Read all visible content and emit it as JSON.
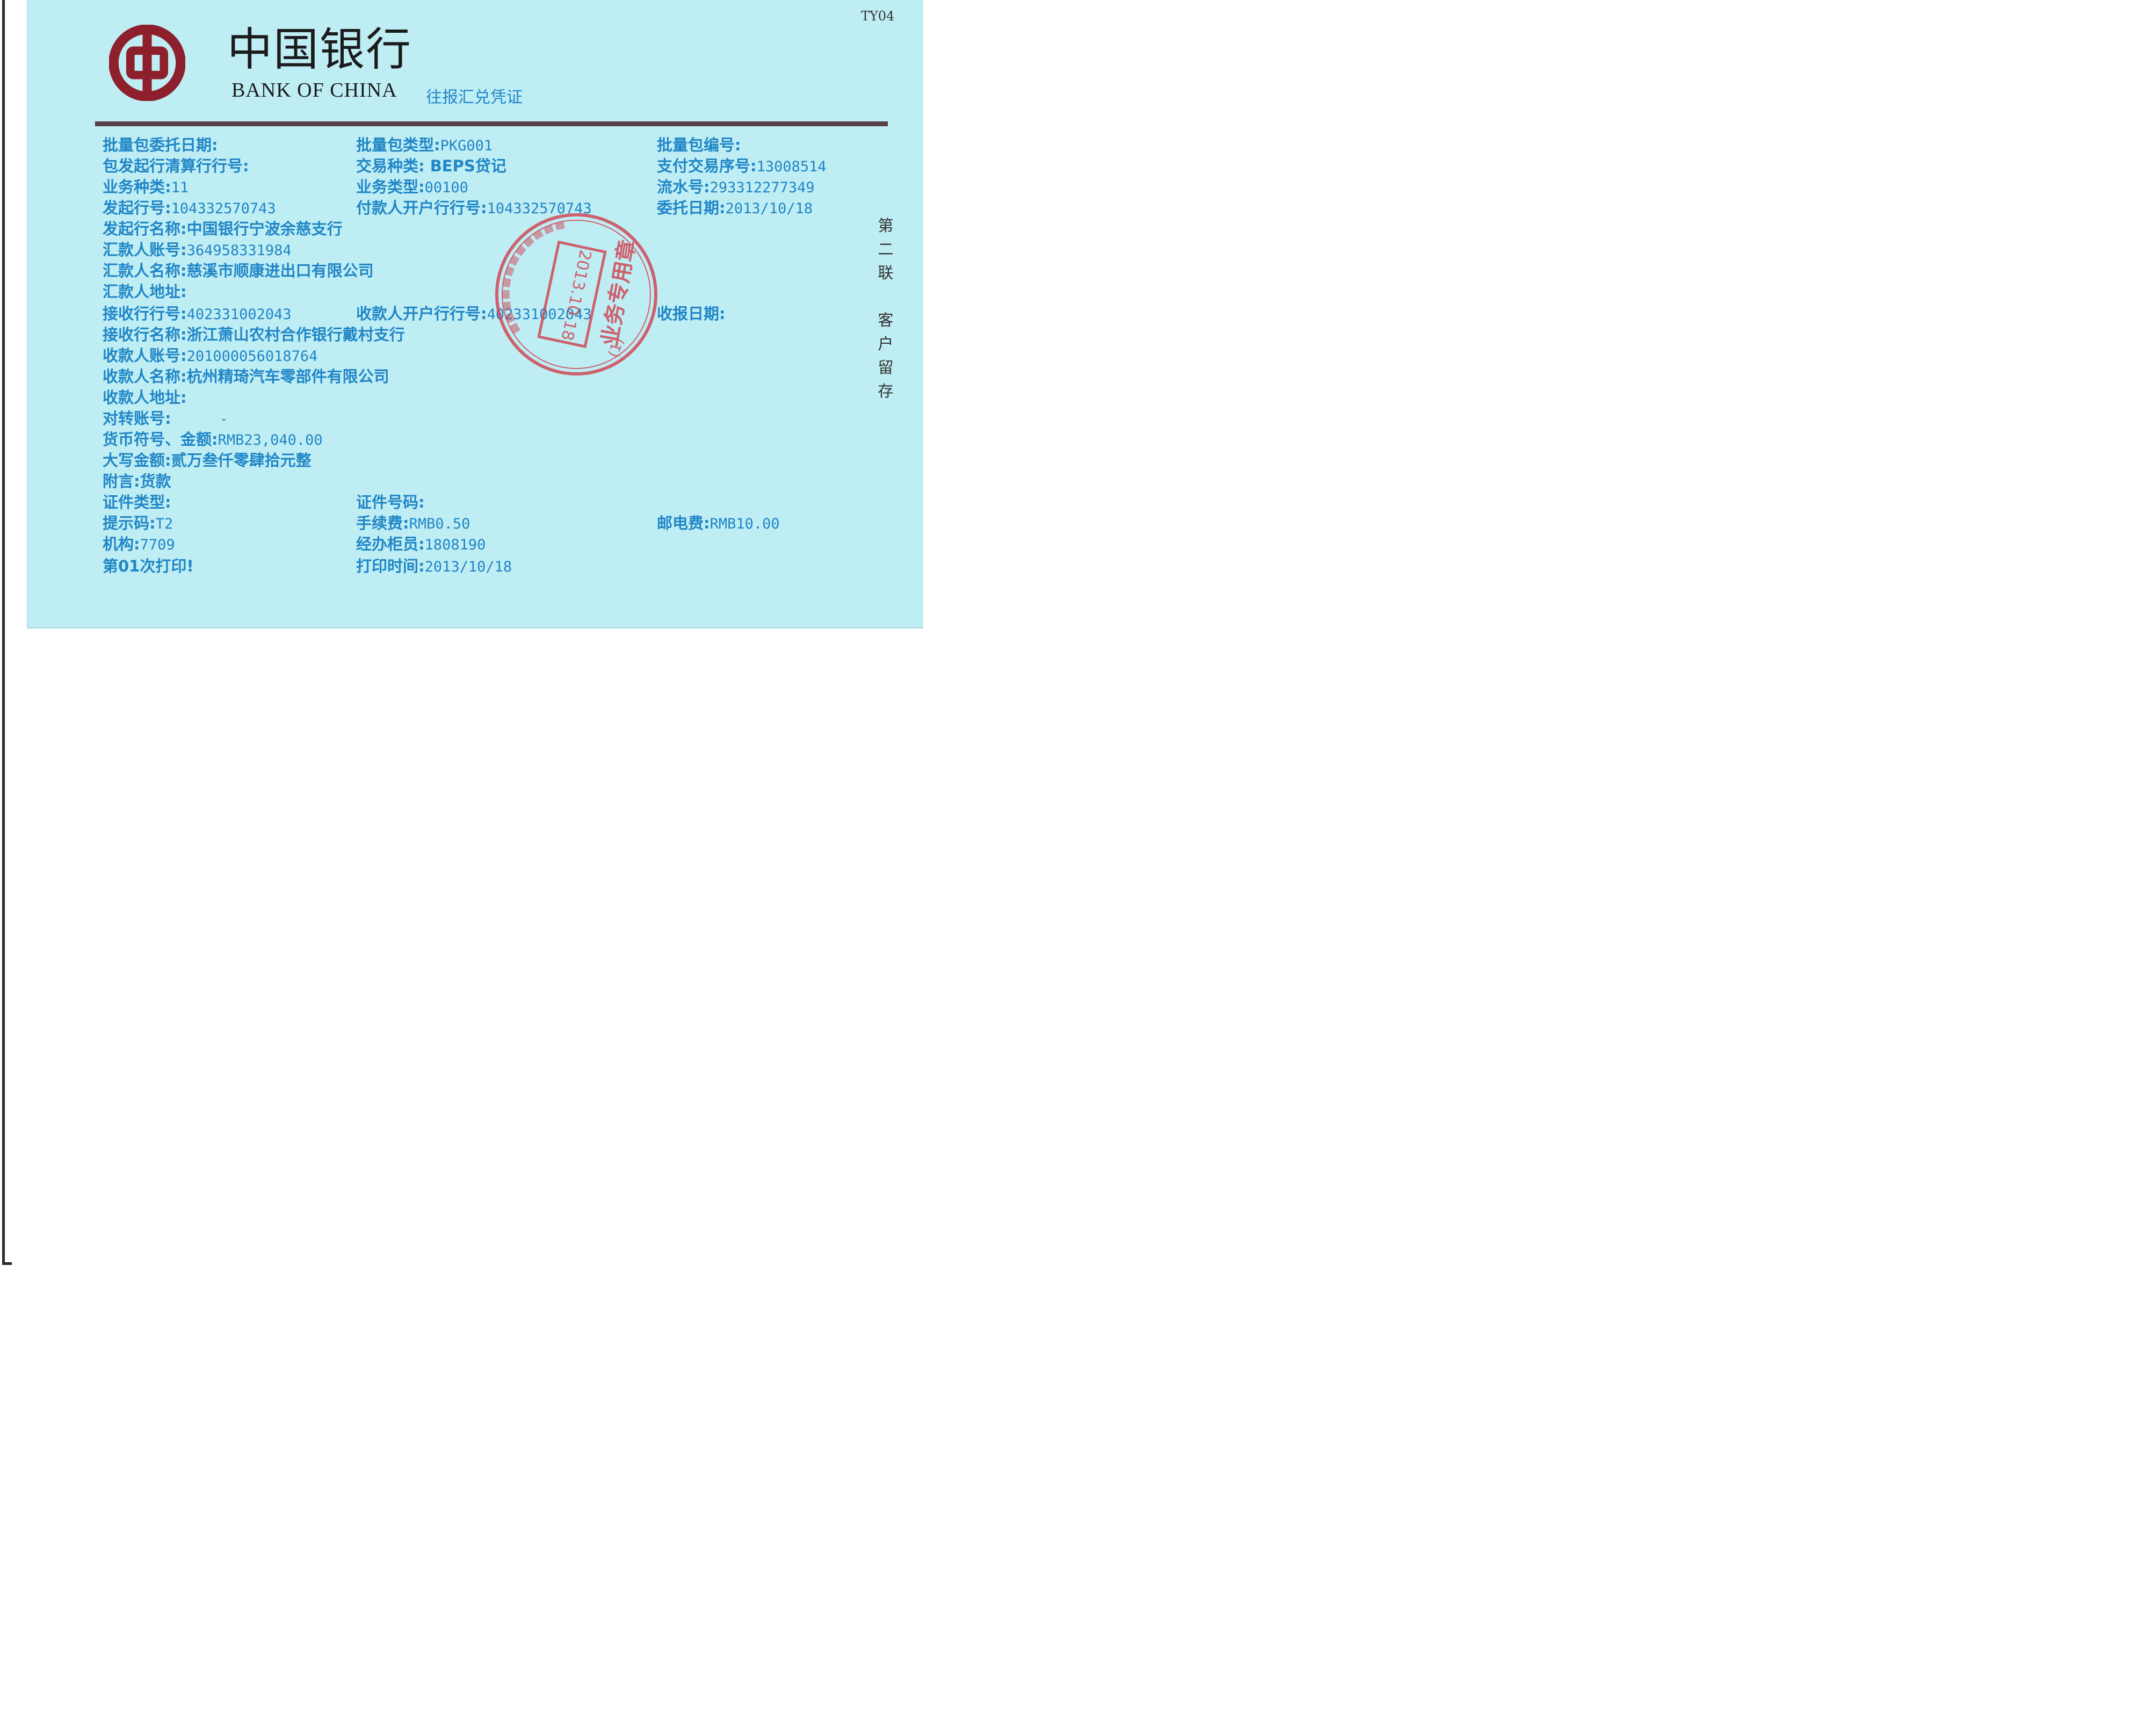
{
  "form_code": "TY04",
  "bank": {
    "name_cn": "中国银行",
    "name_en": "BANK OF CHINA",
    "doc_title": "往报汇兑凭证"
  },
  "fields": {
    "pkg_date": {
      "label": "批量包委托日期:",
      "value": ""
    },
    "pkg_type": {
      "label": "批量包类型:",
      "value": "PKG001"
    },
    "pkg_no": {
      "label": "批量包编号:",
      "value": ""
    },
    "clearing_bank": {
      "label": "包发起行清算行行号:",
      "value": ""
    },
    "txn_kind": {
      "label": "交易种类:",
      "value": " BEPS贷记"
    },
    "pay_seq": {
      "label": "支付交易序号:",
      "value": "13008514"
    },
    "biz_category": {
      "label": "业务种类:",
      "value": "11"
    },
    "biz_type": {
      "label": "业务类型:",
      "value": "00100"
    },
    "serial_no": {
      "label": "流水号:",
      "value": "293312277349"
    },
    "orig_bank_no": {
      "label": "发起行号:",
      "value": "104332570743"
    },
    "payer_bank_no": {
      "label": "付款人开户行行号:",
      "value": "104332570743"
    },
    "entrust_date": {
      "label": "委托日期:",
      "value": "2013/10/18"
    },
    "orig_bank_name": {
      "label": "发起行名称:",
      "value": "中国银行宁波余慈支行"
    },
    "remitter_acct": {
      "label": "汇款人账号:",
      "value": "364958331984"
    },
    "remitter_name": {
      "label": "汇款人名称:",
      "value": "慈溪市顺康进出口有限公司"
    },
    "remitter_addr": {
      "label": "汇款人地址:",
      "value": ""
    },
    "recv_bank_no": {
      "label": "接收行行号:",
      "value": "402331002043"
    },
    "payee_bank_no": {
      "label": "收款人开户行行号:",
      "value": "402331002043"
    },
    "recv_date": {
      "label": "收报日期:",
      "value": ""
    },
    "recv_bank_name": {
      "label": "接收行名称:",
      "value": "浙江萧山农村合作银行戴村支行"
    },
    "payee_acct": {
      "label": "收款人账号:",
      "value": "201000056018764"
    },
    "payee_name": {
      "label": "收款人名称:",
      "value": "杭州精琦汽车零部件有限公司"
    },
    "payee_addr": {
      "label": "收款人地址:",
      "value": ""
    },
    "transfer_acct": {
      "label": "对转账号:",
      "value": "-"
    },
    "currency_amount": {
      "label": "货币符号、金额:",
      "value": "RMB23,040.00"
    },
    "amount_words": {
      "label": "大写金额:",
      "value": "贰万叁仟零肆拾元整"
    },
    "note": {
      "label": "附言:",
      "value": "货款"
    },
    "id_type": {
      "label": "证件类型:",
      "value": ""
    },
    "id_no": {
      "label": "证件号码:",
      "value": ""
    },
    "prompt_code": {
      "label": "提示码:",
      "value": "T2"
    },
    "fee": {
      "label": "手续费:",
      "value": "RMB0.50"
    },
    "postal_fee": {
      "label": "邮电费:",
      "value": "RMB10.00"
    },
    "org": {
      "label": "机构:",
      "value": "7709"
    },
    "teller": {
      "label": "经办柜员:",
      "value": "1808190"
    },
    "print_count": {
      "label": "第01次打印!",
      "value": ""
    },
    "print_time": {
      "label": "打印时间:",
      "value": "2013/10/18"
    }
  },
  "side_note": [
    "第",
    "二",
    "联",
    "客",
    "户",
    "留",
    "存"
  ],
  "seal": {
    "date": "2013.10.18",
    "text": "业务专用章",
    "number": "(1)"
  },
  "colors": {
    "paper": "#bfedf4",
    "print": "#2086c6",
    "seal": "#d23a48",
    "logo": "#8e1f2c"
  }
}
